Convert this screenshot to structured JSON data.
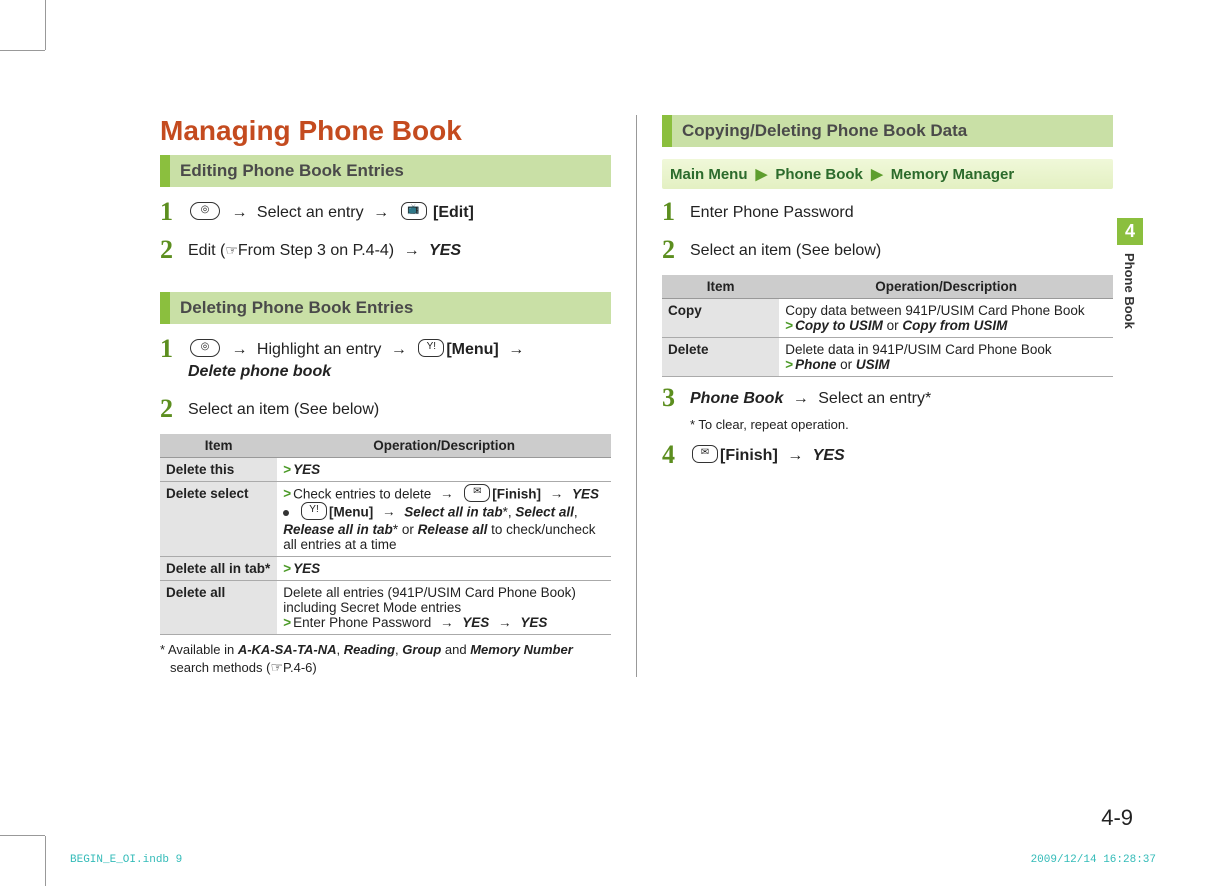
{
  "page": {
    "number": "4-9",
    "tab_number": "4",
    "tab_label": "Phone Book"
  },
  "left": {
    "title": "Managing Phone Book",
    "editing": {
      "heading": "Editing Phone Book Entries",
      "step1_a": "Select an entry",
      "step1_b": "[Edit]",
      "step2_a": "Edit (",
      "step2_b": "From Step 3 on P.4-4)",
      "step2_c": "YES"
    },
    "deleting": {
      "heading": "Deleting Phone Book Entries",
      "step1_a": "Highlight an entry",
      "step1_b": "[Menu]",
      "step1_c": "Delete phone book",
      "step2": "Select an item (See below)",
      "table_header_item": "Item",
      "table_header_op": "Operation/Description",
      "rows": {
        "delete_this": {
          "item": "Delete this",
          "op": "YES"
        },
        "delete_select": {
          "item": "Delete select",
          "line1_a": "Check entries to delete",
          "line1_b": "[Finish]",
          "line1_c": "YES",
          "line2_a": "[Menu]",
          "line2_b": "Select all in tab",
          "line2_c": "Select all",
          "line2_d": "Release all in tab",
          "line2_e": "Release all",
          "line2_f": " to check/uncheck all entries at a time"
        },
        "delete_all_tab": {
          "item": "Delete all in tab*",
          "op": "YES"
        },
        "delete_all": {
          "item": "Delete all",
          "desc": "Delete all entries (941P/USIM Card Phone Book) including Secret Mode entries",
          "seq_a": "Enter Phone Password",
          "seq_b": "YES",
          "seq_c": "YES"
        }
      },
      "footnote_a": "* Available in ",
      "footnote_b": "A-KA-SA-TA-NA",
      "footnote_c": "Reading",
      "footnote_d": "Group",
      "footnote_e": "Memory Number",
      "footnote_f": " search methods (",
      "footnote_g": "P.4-6)"
    }
  },
  "right": {
    "copying": {
      "heading": "Copying/Deleting Phone Book Data",
      "bc_a": "Main Menu",
      "bc_b": "Phone Book",
      "bc_c": "Memory Manager",
      "step1": "Enter Phone Password",
      "step2": "Select an item (See below)",
      "table_header_item": "Item",
      "table_header_op": "Operation/Description",
      "rows": {
        "copy": {
          "item": "Copy",
          "desc": "Copy data between 941P/USIM Card Phone Book",
          "opt_a": "Copy to USIM",
          "or1": " or ",
          "opt_b": "Copy from USIM"
        },
        "delete": {
          "item": "Delete",
          "desc": "Delete data in 941P/USIM Card Phone Book",
          "opt_a": "Phone",
          "or1": " or ",
          "opt_b": "USIM"
        }
      },
      "step3_a": "Phone Book",
      "step3_b": "Select an entry*",
      "step3_note": "* To clear, repeat operation.",
      "step4_a": "[Finish]",
      "step4_b": "YES"
    }
  },
  "footer": {
    "left": "BEGIN_E_OI.indb   9",
    "right": "2009/12/14   16:28:37"
  }
}
